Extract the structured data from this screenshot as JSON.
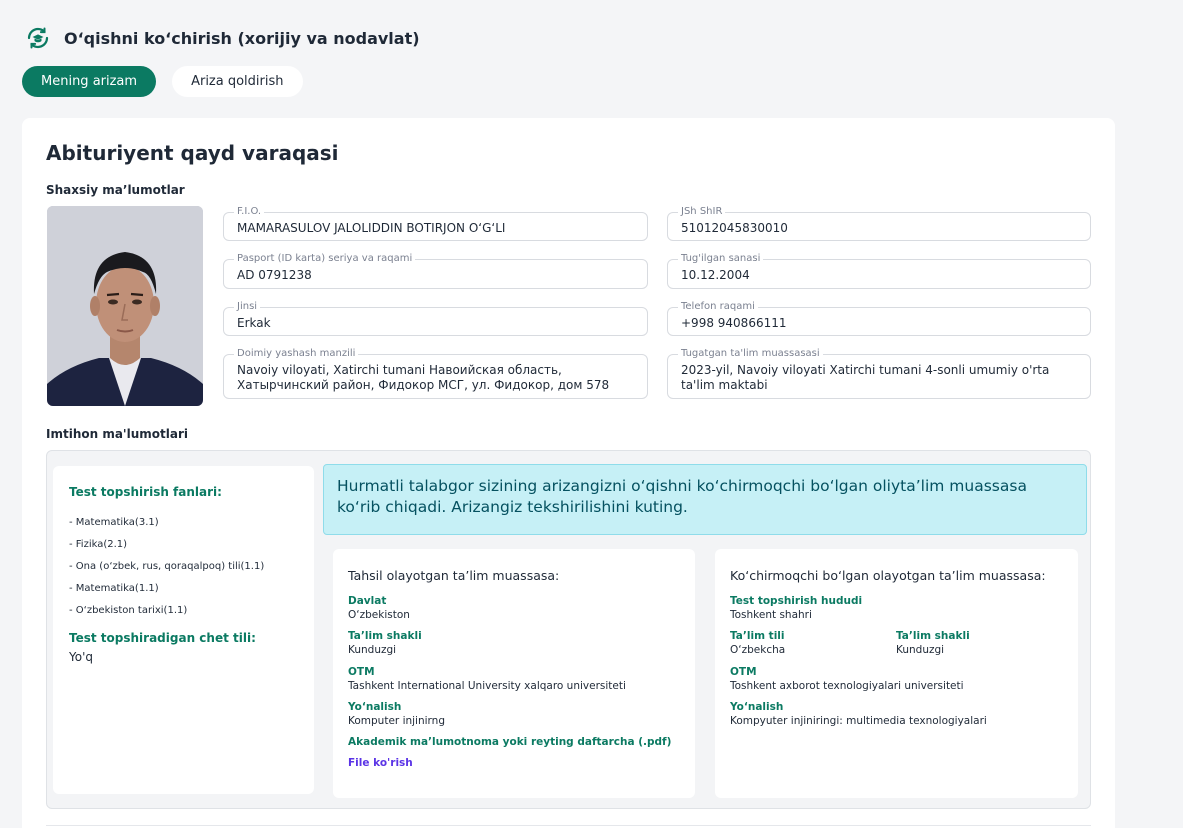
{
  "header": {
    "title": "O‘qishni ko‘chirish (xorijiy va nodavlat)",
    "icon": "graduation-transfer-icon"
  },
  "tabs": [
    {
      "label": "Mening arizam",
      "active": true
    },
    {
      "label": "Ariza qoldirish",
      "active": false
    }
  ],
  "card": {
    "title": "Abituriyent qayd varaqasi",
    "personal_label": "Shaxsiy ma’lumotlar",
    "exam_label": "Imtihon ma'lumotlari"
  },
  "fields": {
    "fio": {
      "label": "F.I.O.",
      "value": "MAMARASULOV JALOLIDDIN BOTIRJON O‘G‘LI"
    },
    "jshshir": {
      "label": "JSh ShIR",
      "value": "51012045830010"
    },
    "passport": {
      "label": "Pasport (ID karta) seriya va raqami",
      "value": "AD 0791238"
    },
    "birth": {
      "label": "Tug'ilgan sanasi",
      "value": "10.12.2004"
    },
    "gender": {
      "label": "Jinsi",
      "value": "Erkak"
    },
    "phone": {
      "label": "Telefon raqami",
      "value": "+998 940866111"
    },
    "address": {
      "label": "Doimiy yashash manzili",
      "value": "Navoiy viloyati, Xatirchi tumani Навоийская область, Хатырчинский район, Фидокор МСГ, ул. Фидокор, дом 578"
    },
    "school": {
      "label": "Tugatgan ta'lim muassasasi",
      "value": "2023-yil, Navoiy viloyati Xatirchi tumani 4-sonli umumiy o'rta ta'lim maktabi"
    }
  },
  "exam": {
    "subjects_title": "Test topshirish fanlari:",
    "subjects": [
      "- Matematika(3.1)",
      "- Fizika(2.1)",
      "- Ona (o‘zbek, rus, qoraqalpoq) tili(1.1)",
      "- Matematika(1.1)",
      "- O‘zbekiston tarixi(1.1)"
    ],
    "foreign_title": "Test topshiradigan chet tili:",
    "foreign_value": "Yo'q"
  },
  "notice": "Hurmatli talabgor sizining arizangizni o‘qishni ko‘chirmoqchi bo‘lgan oliyta’lim muassasa ko‘rib chiqadi. Arizangiz tekshirilishini kuting.",
  "current_inst": {
    "title": "Tahsil olayotgan ta’lim muassasa:",
    "country_label": "Davlat",
    "country": "O‘zbekiston",
    "form_label": "Ta’lim shakli",
    "form": "Kunduzgi",
    "otm_label": "OTM",
    "otm": "Tashkent International University xalqaro universiteti",
    "direction_label": "Yo‘nalish",
    "direction": "Komputer injinirng",
    "doc_label": "Akademik ma’lumotnoma yoki reyting daftarcha (.pdf)",
    "file_link": "File ko'rish"
  },
  "target_inst": {
    "title": "Ko‘chirmoqchi bo‘lgan olayotgan ta’lim muassasa:",
    "region_label": "Test topshirish hududi",
    "region": "Toshkent shahri",
    "lang_label": "Ta’lim tili",
    "lang": "O‘zbekcha",
    "form_label": "Ta’lim shakli",
    "form": "Kunduzgi",
    "otm_label": "OTM",
    "otm": "Toshkent axborot texnologiyalari universiteti",
    "direction_label": "Yo‘nalish",
    "direction": "Kompyuter injiniringi: multimedia texnologiyalari"
  },
  "colors": {
    "brand": "#0b7a62",
    "notice_bg": "#c6f0f6",
    "link": "#5b34e6"
  }
}
